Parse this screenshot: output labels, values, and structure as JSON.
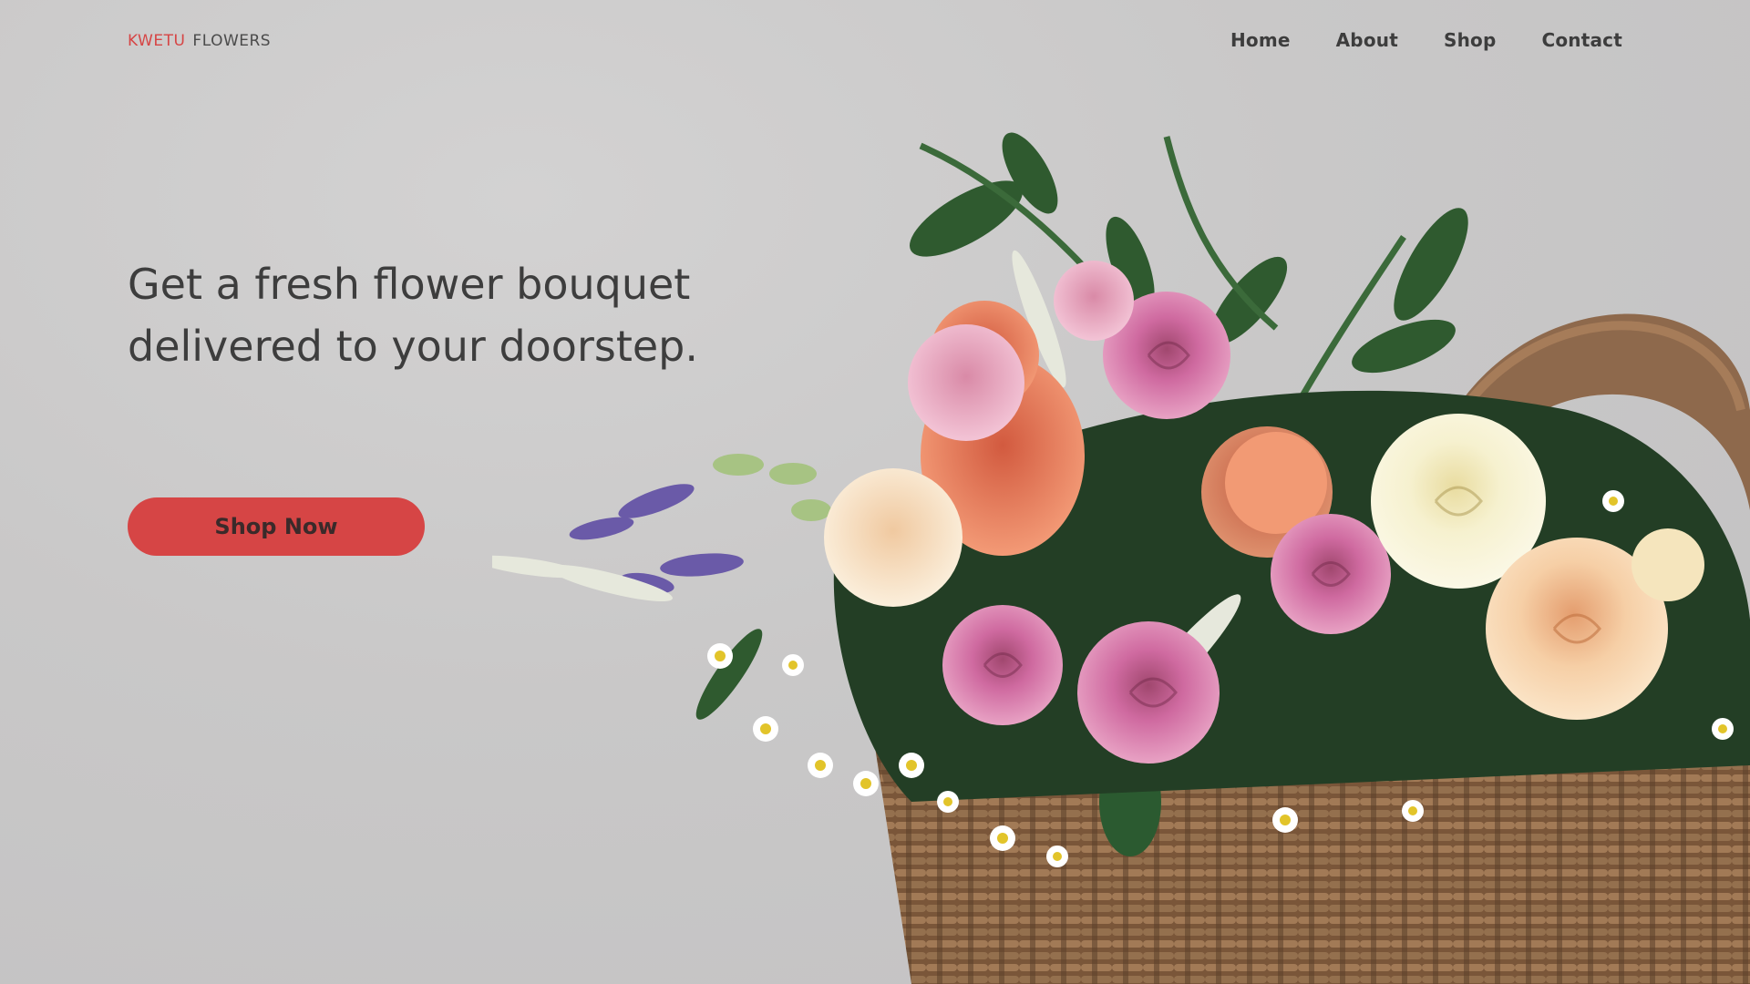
{
  "logo": {
    "primary": "KWETU",
    "secondary": "FLOWERS",
    "primary_color": "#d64545"
  },
  "nav": {
    "items": [
      {
        "label": "Home"
      },
      {
        "label": "About"
      },
      {
        "label": "Shop"
      },
      {
        "label": "Contact"
      }
    ]
  },
  "hero": {
    "headline": "Get a fresh flower bouquet delivered to your doorstep.",
    "cta_label": "Shop Now",
    "cta_color": "#d64545",
    "image": "flower-bouquet-in-wicker-basket"
  }
}
